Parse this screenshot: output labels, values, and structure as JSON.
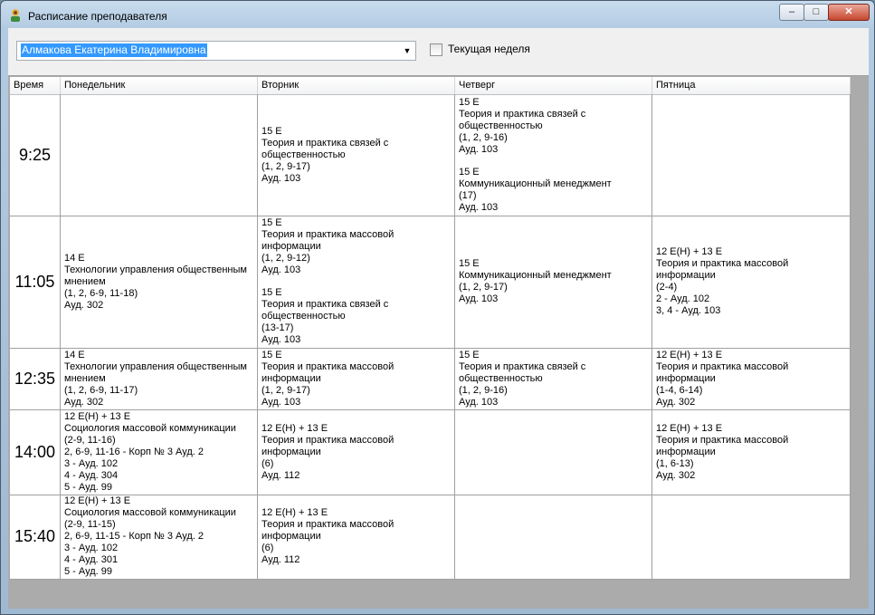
{
  "window": {
    "title": "Расписание преподавателя",
    "controls": {
      "minimize": "–",
      "maximize": "□",
      "close": "✕"
    }
  },
  "toolbar": {
    "teacher": "Алмакова Екатерина Владимировна",
    "dropdown_arrow": "▼",
    "current_week_label": "Текущая неделя",
    "current_week_checked": false
  },
  "schedule": {
    "columns": [
      "Время",
      "Понедельник",
      "Вторник",
      "Четверг",
      "Пятница"
    ],
    "rows": [
      {
        "time": "9:25",
        "cells": [
          [],
          [
            [
              "15 Е",
              "Теория и практика связей с общественностью",
              "(1, 2, 9-17)",
              "Ауд. 103"
            ]
          ],
          [
            [
              "15 Е",
              "Теория и практика связей с общественностью",
              "(1, 2, 9-16)",
              "Ауд. 103"
            ],
            [
              "15 Е",
              "Коммуникационный менеджмент",
              "(17)",
              "Ауд. 103"
            ]
          ],
          []
        ]
      },
      {
        "time": "11:05",
        "cells": [
          [
            [
              "14 Е",
              "Технологии управления общественным мнением",
              "(1, 2, 6-9, 11-18)",
              "Ауд. 302"
            ]
          ],
          [
            [
              "15 Е",
              "Теория и практика массовой информации",
              "(1, 2, 9-12)",
              "Ауд. 103"
            ],
            [
              "15 Е",
              "Теория и практика связей с общественностью",
              "(13-17)",
              "Ауд. 103"
            ]
          ],
          [
            [
              "15 Е",
              "Коммуникационный менеджмент",
              "(1, 2, 9-17)",
              "Ауд. 103"
            ]
          ],
          [
            [
              "12 Е(Н) + 13 Е",
              "Теория и практика массовой информации",
              "(2-4)",
              "2 - Ауд. 102",
              "3, 4 - Ауд. 103"
            ]
          ]
        ]
      },
      {
        "time": "12:35",
        "cells": [
          [
            [
              "14 Е",
              "Технологии управления общественным мнением",
              "(1, 2, 6-9, 11-17)",
              "Ауд. 302"
            ]
          ],
          [
            [
              "15 Е",
              "Теория и практика массовой информации",
              "(1, 2, 9-17)",
              "Ауд. 103"
            ]
          ],
          [
            [
              "15 Е",
              "Теория и практика связей с общественностью",
              "(1, 2, 9-16)",
              "Ауд. 103"
            ]
          ],
          [
            [
              "12 Е(Н) + 13 Е",
              "Теория и практика массовой информации",
              "(1-4, 6-14)",
              "Ауд. 302"
            ]
          ]
        ]
      },
      {
        "time": "14:00",
        "cells": [
          [
            [
              "12 Е(Н) + 13 Е",
              "Социология массовой коммуникации",
              "(2-9, 11-16)",
              "2, 6-9, 11-16 - Корп № 3 Ауд. 2",
              "3 - Ауд. 102",
              "4 - Ауд. 304",
              "5 - Ауд. 99"
            ]
          ],
          [
            [
              "12 Е(Н) + 13 Е",
              "Теория и практика массовой информации",
              "(6)",
              "Ауд. 112"
            ]
          ],
          [],
          [
            [
              "12 Е(Н) + 13 Е",
              "Теория и практика массовой информации",
              "(1, 6-13)",
              "Ауд. 302"
            ]
          ]
        ]
      },
      {
        "time": "15:40",
        "cells": [
          [
            [
              "12 Е(Н) + 13 Е",
              "Социология массовой коммуникации",
              "(2-9, 11-15)",
              "2, 6-9, 11-15 - Корп № 3 Ауд. 2",
              "3 - Ауд. 102",
              "4 - Ауд. 301",
              "5 - Ауд. 99"
            ]
          ],
          [
            [
              "12 Е(Н) + 13 Е",
              "Теория и практика массовой информации",
              "(6)",
              "Ауд. 112"
            ]
          ],
          [],
          []
        ]
      }
    ]
  }
}
